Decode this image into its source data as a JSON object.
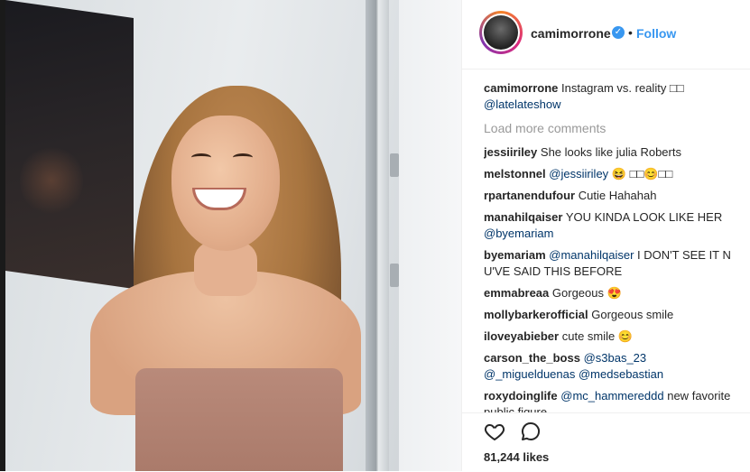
{
  "post": {
    "username": "camimorrone",
    "follow_label": "Follow",
    "separator": "•",
    "verified_glyph": "✓",
    "caption_user": "camimorrone",
    "caption_text": "Instagram vs. reality □□",
    "caption_mention": "@latelateshow",
    "load_more": "Load more comments",
    "likes": "81,244 likes"
  },
  "comments": [
    {
      "user": "jessiiriley",
      "text": "She looks like julia Roberts"
    },
    {
      "user": "melstonnel",
      "mention": "@jessiiriley",
      "text": " 😆 □□😊□□"
    },
    {
      "user": "rpartanendufour",
      "text": "Cutie Hahahah"
    },
    {
      "user": "manahilqaiser",
      "text": "YOU KINDA LOOK LIKE HER",
      "mention2": "@byemariam"
    },
    {
      "user": "byemariam",
      "mention": "@manahilqaiser",
      "text": " I DON'T SEE IT N U'VE SAID THIS BEFORE"
    },
    {
      "user": "emmabreaa",
      "text": "Gorgeous 😍"
    },
    {
      "user": "mollybarkerofficial",
      "text": "Gorgeous smile"
    },
    {
      "user": "iloveyabieber",
      "text": "cute smile 😊"
    },
    {
      "user": "carson_the_boss",
      "mention": "@s3bas_23",
      "mention2": "@_miguelduenas @medsebastian"
    },
    {
      "user": "roxydoinglife",
      "mention": "@mc_hammereddd",
      "text": " new",
      "text2": "favorite public figure"
    }
  ],
  "icons": {
    "like": "heart-icon",
    "comment": "comment-bubble-icon"
  },
  "colors": {
    "link": "#3897f0",
    "mention": "#003569",
    "muted": "#999999",
    "text": "#262626"
  }
}
